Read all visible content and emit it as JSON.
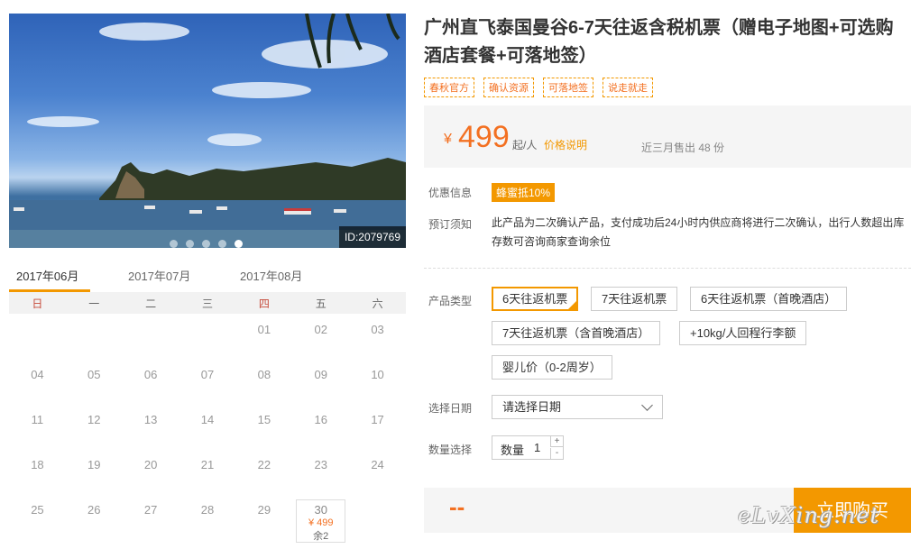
{
  "hero": {
    "photo_id": "ID:2079769",
    "slide_count": 5,
    "active_slide": 4
  },
  "calendar": {
    "months": [
      "2017年06月",
      "2017年07月",
      "2017年08月"
    ],
    "active_month": 0,
    "weekdays": [
      "日",
      "一",
      "二",
      "三",
      "四",
      "五",
      "六"
    ],
    "weeks": [
      [
        "",
        "",
        "",
        "",
        "01",
        "02",
        "03"
      ],
      [
        "04",
        "05",
        "06",
        "07",
        "08",
        "09",
        "10"
      ],
      [
        "11",
        "12",
        "13",
        "14",
        "15",
        "16",
        "17"
      ],
      [
        "18",
        "19",
        "20",
        "21",
        "22",
        "23",
        "24"
      ],
      [
        "25",
        "26",
        "27",
        "28",
        "29",
        "30",
        ""
      ]
    ],
    "available": {
      "day": "30",
      "price": "¥ 499",
      "stock": "余2"
    }
  },
  "product": {
    "title": "广州直飞泰国曼谷6-7天往返含税机票（赠电子地图+可选购酒店套餐+可落地签）",
    "tags": [
      "春秋官方",
      "确认资源",
      "可落地签",
      "说走就走"
    ],
    "price": {
      "currency": "¥",
      "amount": "499",
      "from": "起/人",
      "explain": "价格说明",
      "sold": "近三月售出 48 份"
    },
    "discount": {
      "label": "优惠信息",
      "badge": "蜂蜜抵10%"
    },
    "notice": {
      "label": "预订须知",
      "text": "此产品为二次确认产品，支付成功后24小时内供应商将进行二次确认，出行人数超出库存数可咨询商家查询余位"
    },
    "options": {
      "label": "产品类型",
      "items": [
        "6天往返机票",
        "7天往返机票",
        "6天往返机票（首晚酒店）",
        "7天往返机票（含首晚酒店）",
        "+10kg/人回程行李额",
        "婴儿价（0-2周岁）"
      ],
      "selected": 0
    },
    "date": {
      "label": "选择日期",
      "placeholder": "请选择日期"
    },
    "quantity": {
      "label": "数量选择",
      "field_label": "数量",
      "value": "1",
      "plus": "+",
      "minus": "-"
    },
    "total": "--",
    "buy_label": "立即购买",
    "watermark": "eLvXing.net"
  },
  "colors": {
    "accent": "#f39800",
    "price": "#f37021"
  }
}
